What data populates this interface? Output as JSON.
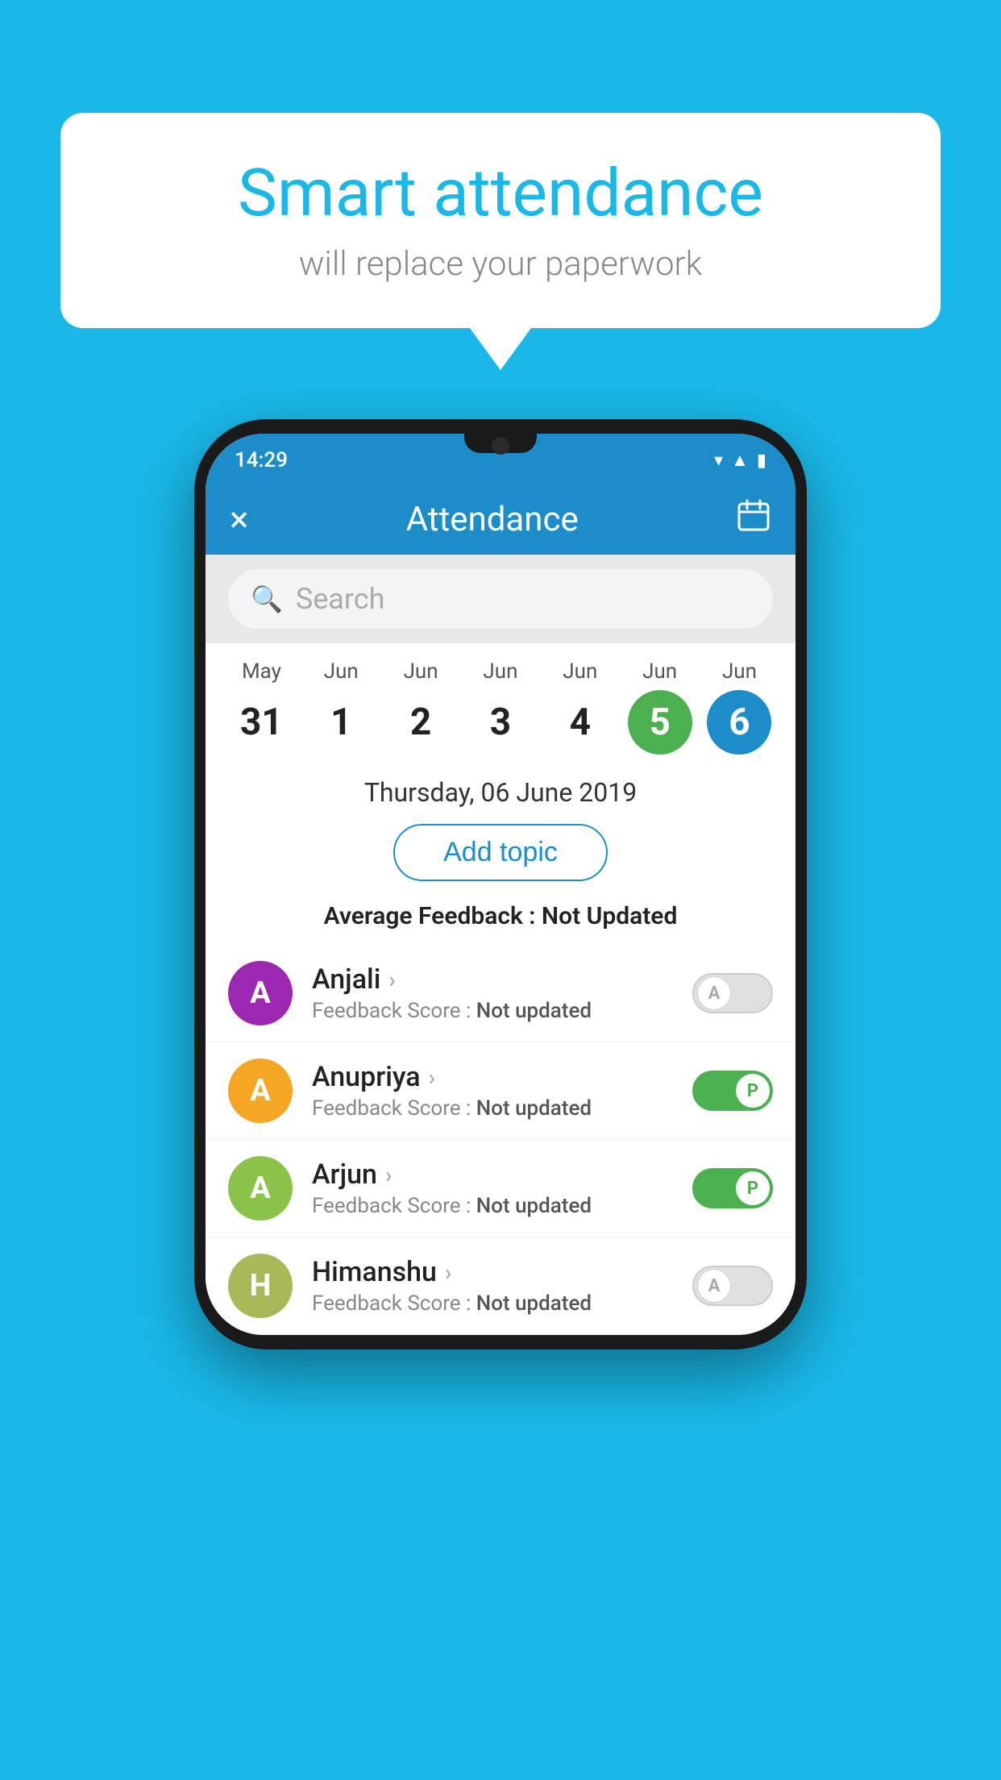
{
  "background_color": "#1ab8e8",
  "speech_bubble": {
    "title": "Smart attendance",
    "subtitle": "will replace your paperwork"
  },
  "status_bar": {
    "time": "14:29",
    "icons": [
      "wifi",
      "signal",
      "battery"
    ]
  },
  "app_bar": {
    "title": "Attendance",
    "close_label": "×",
    "calendar_icon": "calendar"
  },
  "search": {
    "placeholder": "Search"
  },
  "calendar": {
    "days": [
      {
        "month": "May",
        "date": "31",
        "style": "normal"
      },
      {
        "month": "Jun",
        "date": "1",
        "style": "normal"
      },
      {
        "month": "Jun",
        "date": "2",
        "style": "normal"
      },
      {
        "month": "Jun",
        "date": "3",
        "style": "normal"
      },
      {
        "month": "Jun",
        "date": "4",
        "style": "normal"
      },
      {
        "month": "Jun",
        "date": "5",
        "style": "today"
      },
      {
        "month": "Jun",
        "date": "6",
        "style": "selected"
      }
    ]
  },
  "selected_date": "Thursday, 06 June 2019",
  "add_topic_label": "Add topic",
  "avg_feedback_label": "Average Feedback :",
  "avg_feedback_value": "Not Updated",
  "students": [
    {
      "name": "Anjali",
      "avatar_letter": "A",
      "avatar_color": "#9c27b0",
      "feedback_label": "Feedback Score :",
      "feedback_value": "Not updated",
      "attendance": "A",
      "attendance_status": "off"
    },
    {
      "name": "Anupriya",
      "avatar_letter": "A",
      "avatar_color": "#f5a623",
      "feedback_label": "Feedback Score :",
      "feedback_value": "Not updated",
      "attendance": "P",
      "attendance_status": "on"
    },
    {
      "name": "Arjun",
      "avatar_letter": "A",
      "avatar_color": "#8bc34a",
      "feedback_label": "Feedback Score :",
      "feedback_value": "Not updated",
      "attendance": "P",
      "attendance_status": "on"
    },
    {
      "name": "Himanshu",
      "avatar_letter": "H",
      "avatar_color": "#aab857",
      "feedback_label": "Feedback Score :",
      "feedback_value": "Not updated",
      "attendance": "A",
      "attendance_status": "off"
    }
  ]
}
